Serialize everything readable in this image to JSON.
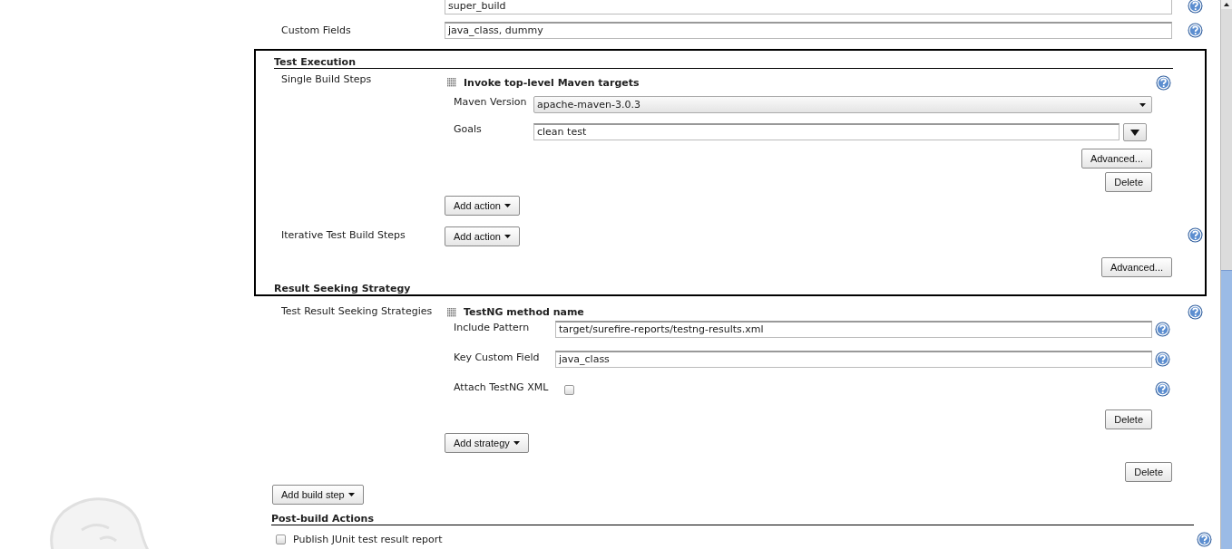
{
  "top_field": {
    "value": "super_build"
  },
  "custom_fields": {
    "label": "Custom Fields",
    "value": "java_class, dummy"
  },
  "test_execution": {
    "heading": "Test Execution",
    "single_build_steps": {
      "label": "Single Build Steps",
      "step": {
        "title": "Invoke top-level Maven targets",
        "maven_version": {
          "label": "Maven Version",
          "value": "apache-maven-3.0.3"
        },
        "goals": {
          "label": "Goals",
          "value": "clean test"
        },
        "advanced_button": "Advanced...",
        "delete_button": "Delete"
      },
      "add_button": "Add action"
    },
    "iterative_build_steps": {
      "label": "Iterative Test Build Steps",
      "add_button": "Add action"
    },
    "advanced_button": "Advanced..."
  },
  "result_seeking": {
    "heading": "Result Seeking Strategy",
    "label": "Test Result Seeking Strategies",
    "strategy": {
      "title": "TestNG method name",
      "include_pattern": {
        "label": "Include Pattern",
        "value": "target/surefire-reports/testng-results.xml"
      },
      "key_custom_field": {
        "label": "Key Custom Field",
        "value": "java_class"
      },
      "attach_xml": {
        "label": "Attach TestNG XML",
        "checked": false
      },
      "delete_button": "Delete"
    },
    "add_button": "Add strategy"
  },
  "delete_button": "Delete",
  "add_build_step": "Add build step",
  "post_build": {
    "heading": "Post-build Actions",
    "actions": [
      {
        "label": "Publish JUnit test result report",
        "checked": false
      }
    ]
  }
}
